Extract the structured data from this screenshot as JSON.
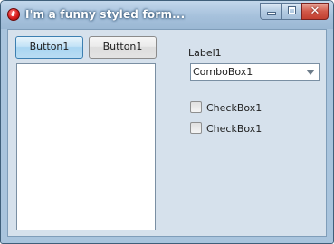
{
  "window": {
    "title": "I'm a funny styled form...",
    "icon": "app-error-icon",
    "controls": {
      "minimize": "minimize-icon",
      "maximize": "maximize-icon",
      "close_glyph": "✕"
    }
  },
  "buttons": [
    {
      "label": "Button1"
    },
    {
      "label": "Button1"
    }
  ],
  "listbox": {
    "items": []
  },
  "label1": {
    "text": "Label1"
  },
  "combobox": {
    "value": "ComboBox1",
    "arrow_icon": "dropdown-arrow-icon"
  },
  "checkboxes": [
    {
      "label": "CheckBox1",
      "checked": false
    },
    {
      "label": "CheckBox1",
      "checked": false
    }
  ],
  "colors": {
    "frame": "#a9c4dd",
    "client": "#d6e1ec",
    "hot_button": "#c4e3f7",
    "close_button": "#d2594a"
  }
}
